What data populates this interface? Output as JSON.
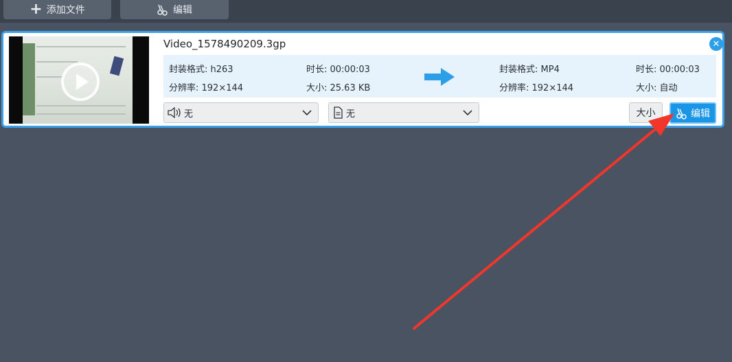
{
  "toolbar": {
    "add_file_label": "添加文件",
    "edit_label": "编辑"
  },
  "file": {
    "name": "Video_1578490209.3gp",
    "source": {
      "format": "封装格式: h263",
      "duration": "时长: 00:00:03",
      "resolution": "分辨率: 192×144",
      "size": "大小: 25.63 KB"
    },
    "target": {
      "format": "封装格式: MP4",
      "duration": "时长: 00:00:03",
      "resolution": "分辨率: 192×144",
      "size": "大小: 自动"
    },
    "audio_select": "无",
    "subtitle_select": "无",
    "size_button": "大小",
    "edit_button": "编辑"
  },
  "colors": {
    "background": "#495361",
    "toolbar": "#3a424d",
    "accent": "#1b95e6",
    "annotation_arrow": "#f2362b"
  },
  "icons": [
    "plus-icon",
    "scissors-icon",
    "close-icon",
    "play-icon",
    "arrow-right-icon",
    "speaker-icon",
    "subtitle-file-icon",
    "chevron-down-icon"
  ]
}
